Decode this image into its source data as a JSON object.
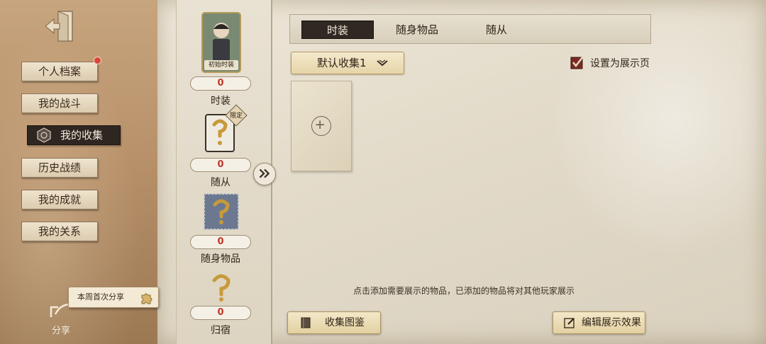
{
  "sidebar": {
    "items": [
      {
        "label": "个人档案"
      },
      {
        "label": "我的战斗"
      },
      {
        "label": "我的收集"
      },
      {
        "label": "历史战绩"
      },
      {
        "label": "我的成就"
      },
      {
        "label": "我的关系"
      }
    ],
    "active_index": 2,
    "share_tip": "本周首次分享",
    "share_label": "分享"
  },
  "categories": [
    {
      "label": "时装",
      "count": "0",
      "card_caption": "初始时装"
    },
    {
      "label": "随从",
      "count": "0",
      "badge": "限定"
    },
    {
      "label": "随身物品",
      "count": "0"
    },
    {
      "label": "归宿",
      "count": "0"
    }
  ],
  "tabs": [
    {
      "label": "时装",
      "active": true
    },
    {
      "label": "随身物品",
      "active": false
    },
    {
      "label": "随从",
      "active": false
    }
  ],
  "collection_dropdown": {
    "selected": "默认收集1"
  },
  "showcase": {
    "label": "设置为展示页",
    "checked": true
  },
  "hint": "点击添加需要展示的物品，已添加的物品将对其他玩家展示",
  "buttons": {
    "catalog": "收集图鉴",
    "edit_display": "编辑展示效果"
  },
  "colors": {
    "counter_text": "#c2372c",
    "active_nav_bg": "#2e2620",
    "notification_dot": "#d9463b"
  }
}
